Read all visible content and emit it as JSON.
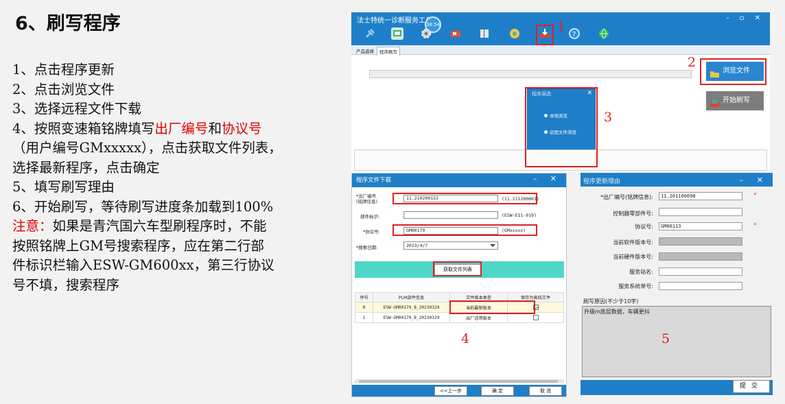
{
  "slide": {
    "title": "6、刷写程序",
    "steps": {
      "s1": "1、点击程序更新",
      "s2": "2、点击浏览文件",
      "s3": "3、选择远程文件下载",
      "s4_a": "4、按照变速箱铭牌填写",
      "s4_red1": "出厂编号",
      "s4_b": "和",
      "s4_red2": "协议号",
      "s4_c": "（用户编号GMxxxxx），点击获取文件列表，",
      "s4_d": "选择最新程序，点击确定",
      "s5": "5、填写刷写理由",
      "s6": "6、开始刷写，等待刷写进度条加载到100%",
      "note_red": "注意：",
      "note_1": "如果是青汽国六车型刷程序时，不能",
      "note_2": "按照铭牌上GM号搜索程序，应在第二行部",
      "note_3": "件标识栏输入ESW-GM600xx，第三行协议",
      "note_4": "号不填，搜索程序"
    }
  },
  "annotations": [
    "1",
    "2",
    "3",
    "4",
    "5"
  ],
  "main_window": {
    "title": "法士特统一诊断服务工具",
    "window_controls": "- ▫ ✕",
    "clock": "38:54",
    "toolbar_icons": [
      "plug-icon",
      "diagnose-icon",
      "gear-icon",
      "parameters-icon",
      "book-icon",
      "gauge-icon",
      "program-update-icon",
      "help-icon",
      "globe-icon"
    ],
    "tabs": [
      "产品选择",
      "程序刷写"
    ],
    "browse_button": "浏览文件",
    "start_button": "开始刷写",
    "source_dialog": {
      "title": "程序源选",
      "options": [
        "本地浏览",
        "远程文件浏览"
      ],
      "ok": "确    定"
    }
  },
  "download_window": {
    "title": "程序文件下载",
    "controls": "– ✕",
    "fields": {
      "serial_label": "*出厂编号\n(铭牌信息)",
      "serial_value": "11.210200153",
      "serial_hint": "(11.211200001)",
      "part_label": "部件标识:",
      "part_value": "",
      "part_hint": "(ESW-E11-019)",
      "protocol_label": "*协议号:",
      "protocol_value": "GM00179",
      "protocol_hint": "(GMxxxxx)",
      "date_label": "*搜索日期:",
      "date_value": "2023/4/7"
    },
    "fetch_button": "获取文件列表",
    "table": {
      "headers": [
        "序号",
        "PLM部件信息",
        "文件版本类型",
        "保存为离线文件"
      ],
      "rows": [
        {
          "idx": "0",
          "plm": "ESW-GM00179_B_20230329",
          "type": "当前最新版本",
          "checked": true
        },
        {
          "idx": "1",
          "plm": "ESW-GM00179_B_20230329",
          "type": "出厂适用版本",
          "checked": false
        }
      ]
    },
    "footer": {
      "prev": "<<上一步",
      "ok": "确    定",
      "cancel": "取    消"
    }
  },
  "reason_window": {
    "title": "程序更新理由",
    "controls": "– ✕",
    "fields": [
      {
        "label": "*出厂编号(铭牌信息):",
        "value": "11.201100098",
        "gray": false,
        "required": true
      },
      {
        "label": "控制器零部件号:",
        "value": "",
        "gray": false,
        "required": false
      },
      {
        "label": "协议号:",
        "value": "GM00113",
        "gray": false,
        "required": true
      },
      {
        "label": "当前软件版本号:",
        "value": "",
        "gray": true,
        "required": false
      },
      {
        "label": "当前硬件版本号:",
        "value": "",
        "gray": true,
        "required": false
      },
      {
        "label": "服务站名:",
        "value": "",
        "gray": false,
        "required": false
      },
      {
        "label": "服务系统单号:",
        "value": "",
        "gray": false,
        "required": false
      }
    ],
    "reason_label": "刷写原因(不少于10字)",
    "reason_text": "升级m底层数据，车辆更抖",
    "submit": "提交",
    "required_mark": "*"
  }
}
